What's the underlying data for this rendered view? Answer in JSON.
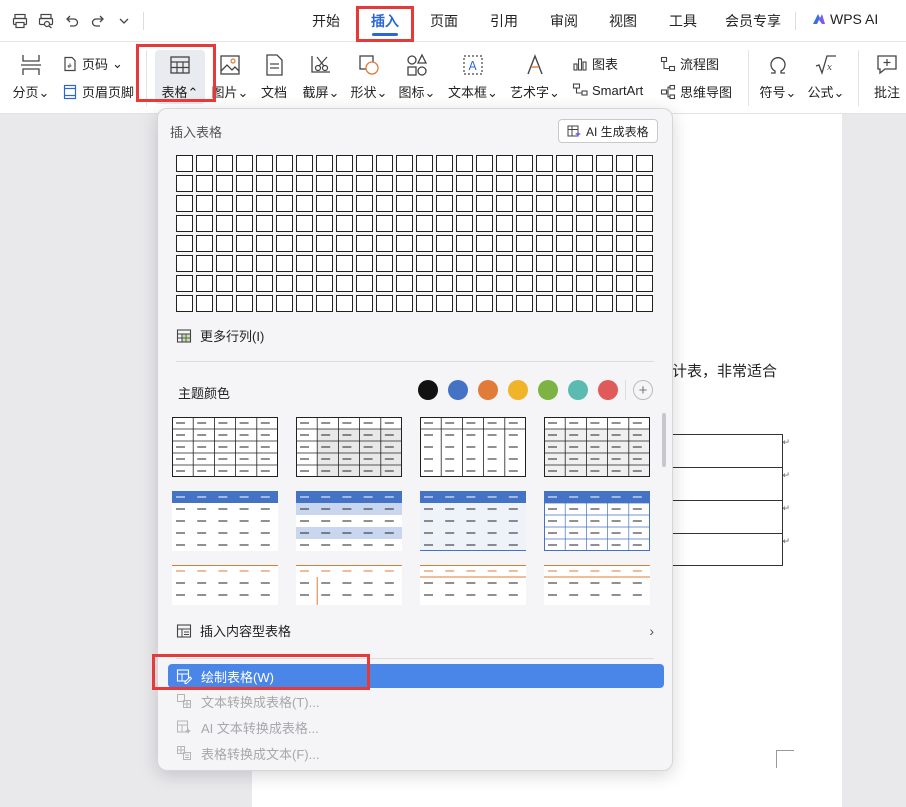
{
  "titlebar": {
    "tabs": [
      {
        "label": "开始"
      },
      {
        "label": "插入"
      },
      {
        "label": "页面"
      },
      {
        "label": "引用"
      },
      {
        "label": "审阅"
      },
      {
        "label": "视图"
      },
      {
        "label": "工具"
      },
      {
        "label": "会员专享"
      }
    ],
    "wps_ai": "WPS AI"
  },
  "ribbon": {
    "page_break": "分页",
    "page_number": "页码",
    "header_footer": "页眉页脚",
    "table": "表格",
    "picture": "图片",
    "document": "文档",
    "screenshot": "截屏",
    "shape": "形状",
    "icon": "图标",
    "textbox": "文本框",
    "wordart": "艺术字",
    "chart": "图表",
    "smartart": "SmartArt",
    "flowchart": "流程图",
    "mindmap": "思维导图",
    "symbol": "符号",
    "formula": "公式",
    "comment": "批注"
  },
  "document": {
    "text_fragment": "计表，非常适合"
  },
  "dropdown": {
    "title": "插入表格",
    "ai_button": "AI 生成表格",
    "grid": {
      "rows": 8,
      "cols": 24
    },
    "more_rows_cols": "更多行列(I)",
    "theme_label": "主题颜色",
    "theme_colors": [
      "#111111",
      "#4472c4",
      "#e07b39",
      "#f0b429",
      "#7cb342",
      "#5bbbb0",
      "#e05a5a"
    ],
    "add_color": "+",
    "content_table": "插入内容型表格",
    "content_table_chevron": "›",
    "menu": [
      {
        "label": "绘制表格(W)",
        "state": "active"
      },
      {
        "label": "文本转换成表格(T)...",
        "state": "disabled"
      },
      {
        "label": "AI 文本转换成表格...",
        "state": "disabled"
      },
      {
        "label": "表格转换成文本(F)...",
        "state": "disabled"
      }
    ]
  },
  "colors": {
    "accent": "#2b66d9",
    "menu_highlight": "#4a86e8",
    "annotation": "#e5393a"
  }
}
